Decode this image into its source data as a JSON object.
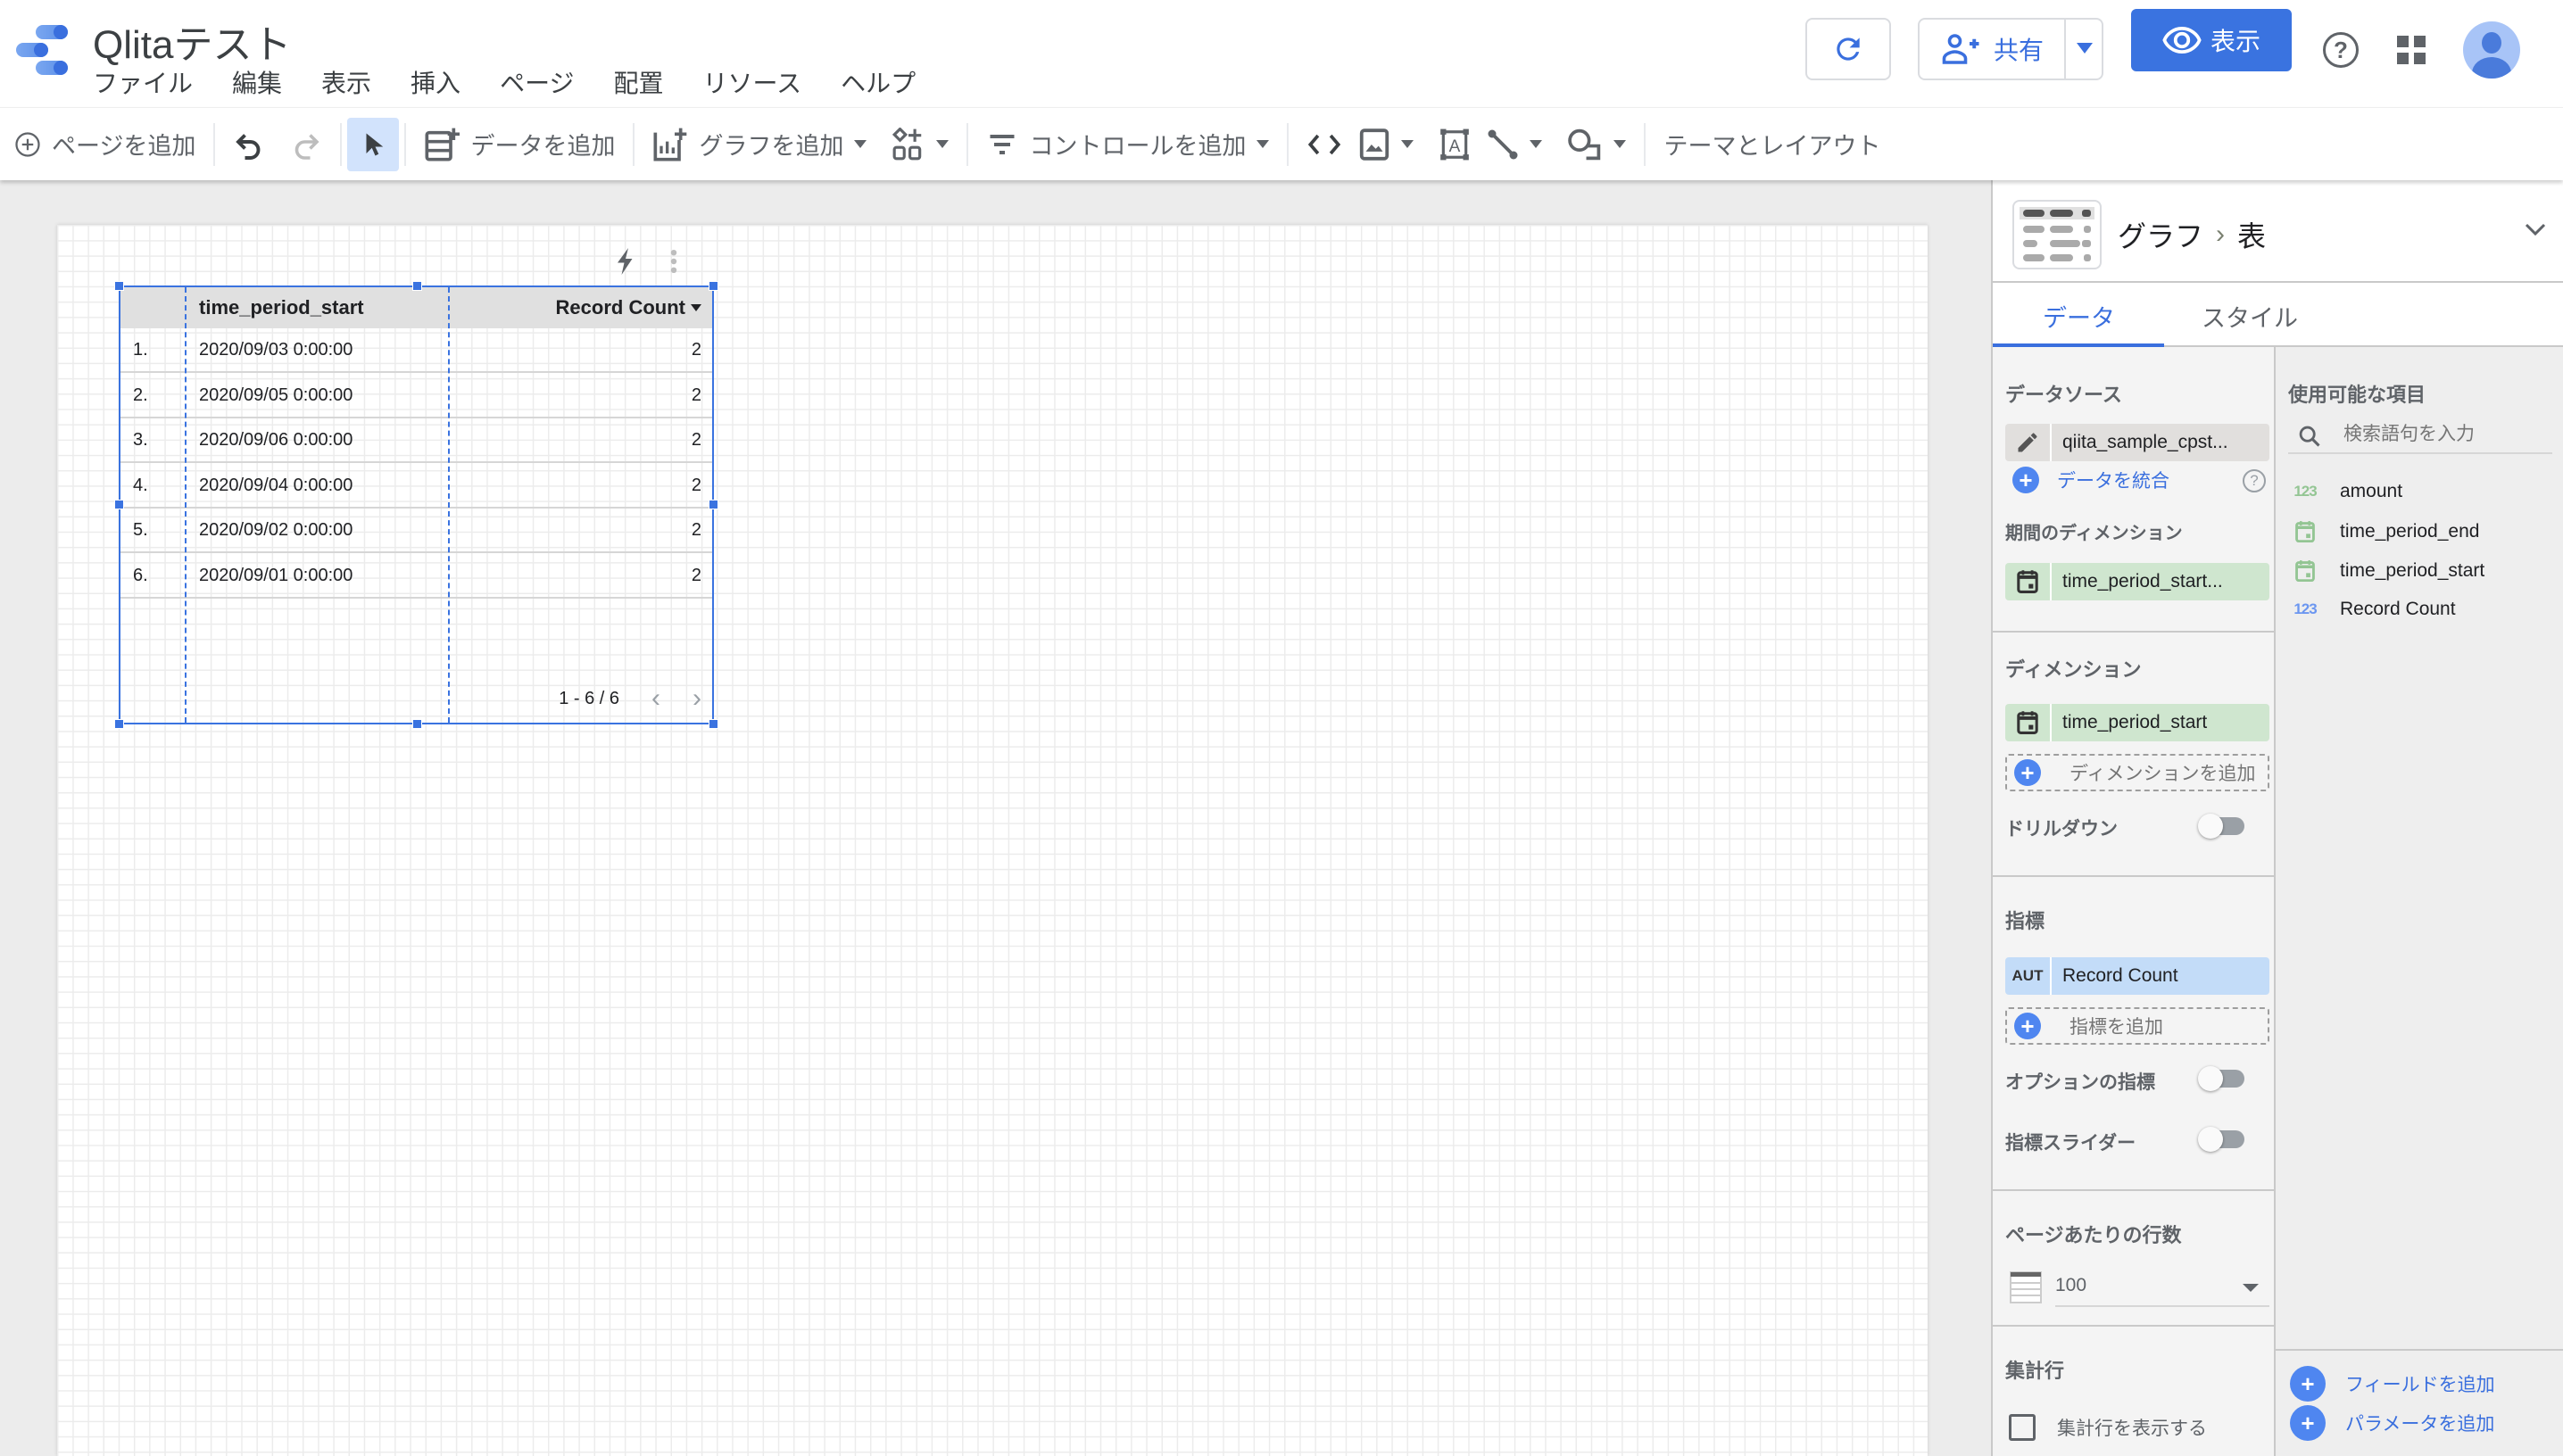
{
  "header": {
    "app_title": "Qlitaテスト",
    "menu": [
      "ファイル",
      "編集",
      "表示",
      "挿入",
      "ページ",
      "配置",
      "リソース",
      "ヘルプ"
    ],
    "share_label": "共有",
    "view_label": "表示",
    "help_glyph": "?"
  },
  "toolbar": {
    "add_page": "ページを追加",
    "add_data": "データを追加",
    "add_chart": "グラフを追加",
    "add_control": "コントロールを追加",
    "theme_layout": "テーマとレイアウト"
  },
  "table_widget": {
    "columns": [
      "time_period_start",
      "Record Count"
    ],
    "sort_column": "Record Count",
    "rows": [
      {
        "index": "1.",
        "time_period_start": "2020/09/03 0:00:00",
        "record_count": "2"
      },
      {
        "index": "2.",
        "time_period_start": "2020/09/05 0:00:00",
        "record_count": "2"
      },
      {
        "index": "3.",
        "time_period_start": "2020/09/06 0:00:00",
        "record_count": "2"
      },
      {
        "index": "4.",
        "time_period_start": "2020/09/04 0:00:00",
        "record_count": "2"
      },
      {
        "index": "5.",
        "time_period_start": "2020/09/02 0:00:00",
        "record_count": "2"
      },
      {
        "index": "6.",
        "time_period_start": "2020/09/01 0:00:00",
        "record_count": "2"
      }
    ],
    "pagination": "1 - 6 / 6",
    "prev_glyph": "‹",
    "next_glyph": "›"
  },
  "panel": {
    "breadcrumb_parent": "グラフ",
    "breadcrumb_sep": "›",
    "breadcrumb_current": "表",
    "tabs": [
      "データ",
      "スタイル"
    ],
    "active_tab": "データ",
    "data_source_title": "データソース",
    "data_source": "qiita_sample_cpst...",
    "blend_data": "データを統合",
    "date_range_dim_title": "期間のディメンション",
    "date_range_dim": "time_period_start...",
    "dimension_title": "ディメンション",
    "dimension": "time_period_start",
    "add_dimension": "ディメンションを追加",
    "drilldown_label": "ドリルダウン",
    "drilldown_on": false,
    "metric_title": "指標",
    "metric_agg": "AUT",
    "metric": "Record Count",
    "add_metric": "指標を追加",
    "optional_metrics_label": "オプションの指標",
    "optional_metrics_on": false,
    "metric_slider_label": "指標スライダー",
    "metric_slider_on": false,
    "rows_per_page_title": "ページあたりの行数",
    "rows_per_page": "100",
    "summary_row_title": "集計行",
    "show_summary_row": "集計行を表示する",
    "show_summary_row_checked": false,
    "available_fields_title": "使用可能な項目",
    "search_placeholder": "検索語句を入力",
    "fields": [
      {
        "type": "number",
        "type_glyph": "123",
        "name": "amount",
        "color": "#93c593"
      },
      {
        "type": "date",
        "name": "time_period_end",
        "color": "#93c593"
      },
      {
        "type": "date",
        "name": "time_period_start",
        "color": "#93c593"
      },
      {
        "type": "number",
        "type_glyph": "123",
        "name": "Record Count",
        "color": "#6b96f0"
      }
    ],
    "add_field": "フィールドを追加",
    "add_parameter": "パラメータを追加"
  },
  "colors": {
    "accent": "#3a73e0",
    "dimension_chip": "#cfe6cf",
    "metric_chip": "#c3dcf8",
    "source_chip": "#e1dfdd"
  }
}
